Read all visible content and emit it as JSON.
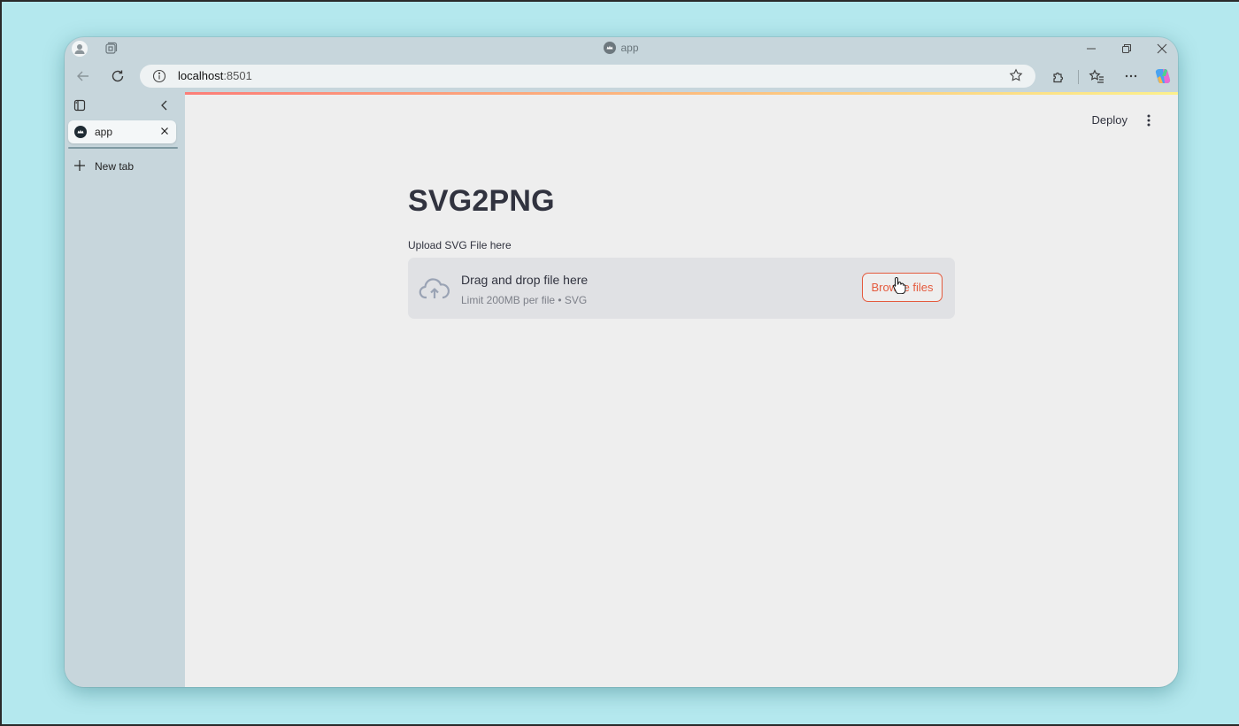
{
  "window": {
    "title": "app"
  },
  "toolbar": {
    "url_host": "localhost",
    "url_port": ":8501"
  },
  "sidebar": {
    "tabs": [
      {
        "label": "app"
      }
    ],
    "new_tab_label": "New tab"
  },
  "app": {
    "deploy_label": "Deploy",
    "title": "SVG2PNG",
    "upload_label": "Upload SVG File here",
    "dropzone_title": "Drag and drop file here",
    "dropzone_subtitle": "Limit 200MB per file • SVG",
    "browse_label": "Browse files"
  },
  "colors": {
    "accent": "#e45a3d",
    "desktop": "#b4e8ee",
    "chrome": "#c7d6dc",
    "content_bg": "#eeeeee"
  },
  "icons": [
    "profile-icon",
    "workspaces-icon",
    "minimize-icon",
    "restore-icon",
    "close-icon",
    "back-icon",
    "refresh-icon",
    "info-icon",
    "favorite-star-icon",
    "extensions-icon",
    "favorites-icon",
    "more-icon",
    "copilot-icon",
    "sidebar-toggle-icon",
    "collapse-icon",
    "app-favicon-icon",
    "tab-close-icon",
    "plus-icon",
    "kebab-menu-icon",
    "cloud-upload-icon",
    "hand-cursor-icon"
  ]
}
